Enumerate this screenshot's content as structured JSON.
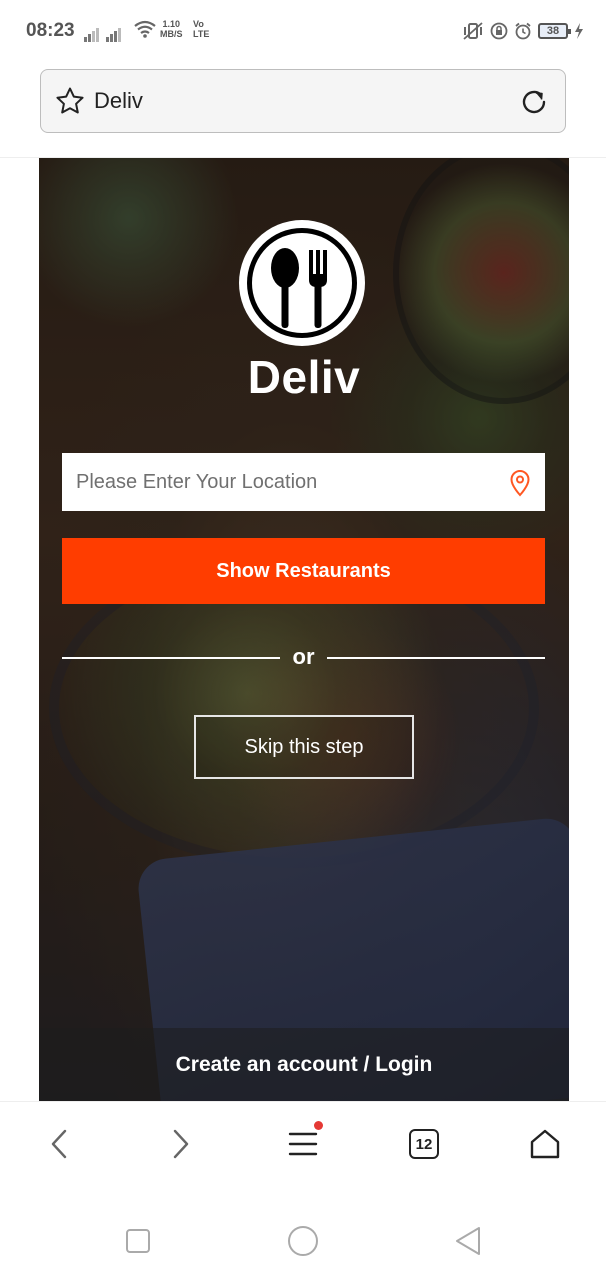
{
  "status_bar": {
    "time": "08:23",
    "net_speed_value": "1.10",
    "net_speed_unit": "MB/S",
    "volte_top": "Vo",
    "volte_bottom": "LTE",
    "battery": "38"
  },
  "url_bar": {
    "title": "Deliv",
    "icons": {
      "left": "star-icon",
      "right": "reload-icon"
    }
  },
  "page": {
    "brand": "Deliv",
    "location_placeholder": "Please Enter Your Location",
    "location_value": "",
    "show_button": "Show Restaurants",
    "or_text": "or",
    "skip_button": "Skip this step",
    "account_link": "Create an account / Login",
    "colors": {
      "accent": "#ff3d00",
      "pin": "#ff5722"
    }
  },
  "toolbar": {
    "tab_count": "12",
    "icons": [
      "back-icon",
      "forward-icon",
      "menu-icon",
      "tabs-icon",
      "home-icon"
    ]
  },
  "system_nav": {
    "icons": [
      "recents-icon",
      "home-circle-icon",
      "back-triangle-icon"
    ]
  }
}
